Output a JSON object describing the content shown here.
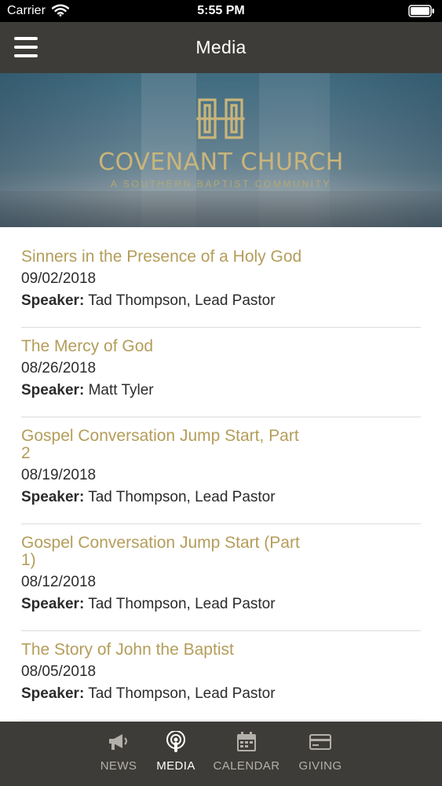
{
  "status_bar": {
    "carrier": "Carrier",
    "time": "5:55 PM"
  },
  "nav": {
    "title": "Media"
  },
  "banner": {
    "church_name": "COVENANT CHURCH",
    "tagline": "A SOUTHERN BAPTIST COMMUNITY"
  },
  "sermons": [
    {
      "title": "Sinners in the Presence of a Holy God",
      "date": "09/02/2018",
      "speaker_label": "Speaker:",
      "speaker": "Tad Thompson, Lead Pastor"
    },
    {
      "title": "The Mercy of God",
      "date": "08/26/2018",
      "speaker_label": "Speaker:",
      "speaker": "Matt Tyler"
    },
    {
      "title": "Gospel Conversation Jump Start, Part 2",
      "date": "08/19/2018",
      "speaker_label": "Speaker:",
      "speaker": "Tad Thompson, Lead Pastor"
    },
    {
      "title": "Gospel Conversation Jump Start (Part 1)",
      "date": "08/12/2018",
      "speaker_label": "Speaker:",
      "speaker": "Tad Thompson, Lead Pastor"
    },
    {
      "title": "The Story of John the Baptist",
      "date": "08/05/2018",
      "speaker_label": "Speaker:",
      "speaker": "Tad Thompson, Lead Pastor"
    }
  ],
  "tabs": [
    {
      "label": "NEWS",
      "icon": "megaphone-icon",
      "active": false
    },
    {
      "label": "MEDIA",
      "icon": "podcast-icon",
      "active": true
    },
    {
      "label": "CALENDAR",
      "icon": "calendar-icon",
      "active": false
    },
    {
      "label": "GIVING",
      "icon": "credit-card-icon",
      "active": false
    }
  ],
  "colors": {
    "nav_background": "#3e3c38",
    "title_gold": "#b49d5a",
    "logo_gold": "#c9b57a"
  }
}
